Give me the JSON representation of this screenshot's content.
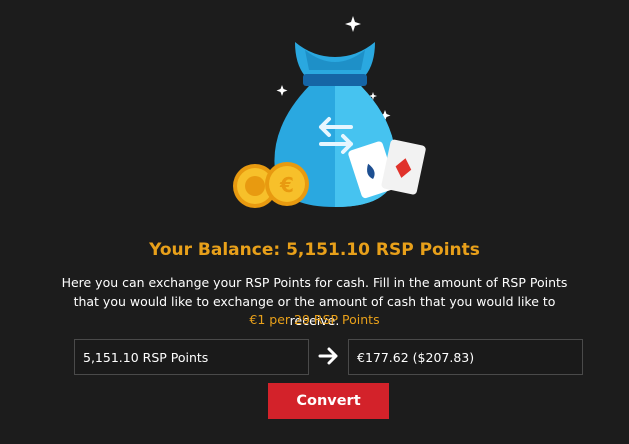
{
  "balance": {
    "label": "Your Balance: 5,151.10 RSP Points"
  },
  "description": "Here you can exchange your RSP Points for cash. Fill in the amount of RSP Points that you would like to exchange or the amount of cash that you would like to receive.",
  "rate": "€1 per 29 RSP Points",
  "exchange": {
    "points_value": "5,151.10 RSP Points",
    "cash_value": "€177.62 ($207.83)"
  },
  "convert_label": "Convert",
  "icons": {
    "illustration": "money-bag-exchange-icon",
    "arrow": "arrow-right-icon"
  },
  "colors": {
    "accent": "#e8a01a",
    "button": "#d3222a",
    "background": "#1c1c1c"
  }
}
